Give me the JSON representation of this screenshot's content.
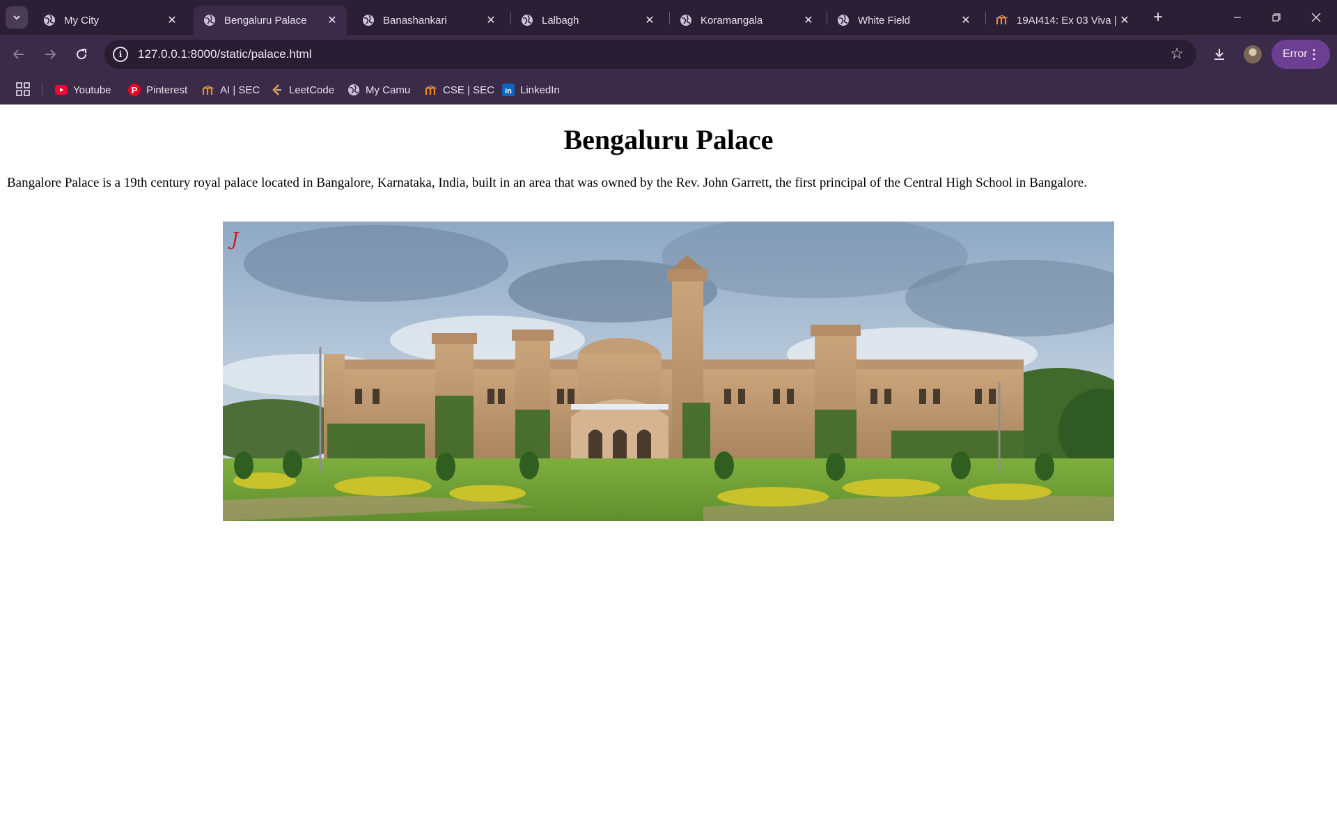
{
  "tabs": [
    {
      "title": "My City",
      "icon": "globe-icon",
      "active": false
    },
    {
      "title": "Bengaluru Palace",
      "icon": "globe-icon",
      "active": true
    },
    {
      "title": "Banashankari",
      "icon": "globe-icon",
      "active": false
    },
    {
      "title": "Lalbagh",
      "icon": "globe-icon",
      "active": false
    },
    {
      "title": "Koramangala",
      "icon": "globe-icon",
      "active": false
    },
    {
      "title": "White Field",
      "icon": "globe-icon",
      "active": false
    },
    {
      "title": "19AI414: Ex 03 Viva |",
      "icon": "moodle-icon",
      "active": false
    }
  ],
  "address_bar": {
    "url": "127.0.0.1:8000/static/palace.html"
  },
  "profile": {
    "status_label": "Error"
  },
  "bookmarks": [
    {
      "label": "Youtube",
      "icon": "youtube-icon"
    },
    {
      "label": "Pinterest",
      "icon": "pinterest-icon"
    },
    {
      "label": "AI | SEC",
      "icon": "moodle-icon"
    },
    {
      "label": "LeetCode",
      "icon": "leetcode-icon"
    },
    {
      "label": "My Camu",
      "icon": "globe-icon"
    },
    {
      "label": "CSE | SEC",
      "icon": "moodle-icon"
    },
    {
      "label": "LinkedIn",
      "icon": "linkedin-icon"
    }
  ],
  "page": {
    "heading": "Bengaluru Palace",
    "description": "Bangalore Palace is a 19th century royal palace located in Bangalore, Karnataka, India, built in an area that was owned by the Rev. John Garrett, the first principal of the Central High School in Bangalore."
  },
  "colors": {
    "tabstrip_bg": "#2b1f36",
    "toolbar_bg": "#3b2b48",
    "error_pill": "#6c3f93",
    "page_bg": "#ffffff"
  }
}
